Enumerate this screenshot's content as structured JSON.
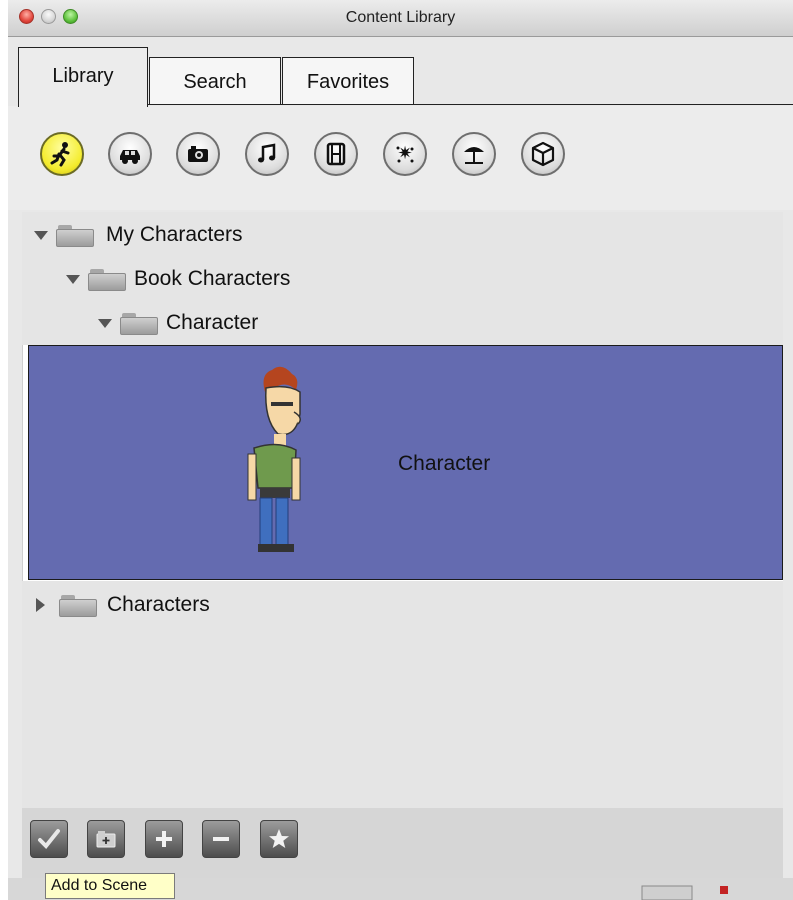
{
  "window": {
    "title": "Content Library"
  },
  "tabs": [
    {
      "label": "Library",
      "active": true
    },
    {
      "label": "Search",
      "active": false
    },
    {
      "label": "Favorites",
      "active": false
    }
  ],
  "categories": [
    {
      "icon": "running-figure-icon",
      "selected": true
    },
    {
      "icon": "car-icon"
    },
    {
      "icon": "camera-icon"
    },
    {
      "icon": "music-note-icon"
    },
    {
      "icon": "film-icon"
    },
    {
      "icon": "stars-icon"
    },
    {
      "icon": "beach-umbrella-icon"
    },
    {
      "icon": "cube-icon"
    }
  ],
  "tree": {
    "my_characters": "My Characters",
    "book_characters": "Book Characters",
    "character_folder": "Character",
    "selected_item": "Character",
    "characters": "Characters"
  },
  "toolbar": {
    "buttons": [
      "check-icon",
      "new-folder-icon",
      "plus-icon",
      "minus-icon",
      "star-icon"
    ],
    "tooltip": "Add to Scene"
  },
  "colors": {
    "selection": "#646bb0",
    "selected_category": "#f4ec2e"
  }
}
